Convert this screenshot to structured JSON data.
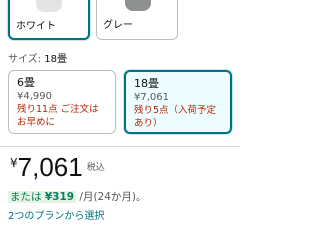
{
  "colors": [
    {
      "label": "ホワイト",
      "thumb": "#e2e4e4",
      "selected": true
    },
    {
      "label": "グレー",
      "thumb": "#8d9090",
      "selected": false
    }
  ],
  "size": {
    "label": "サイズ:",
    "value": "18畳"
  },
  "size_options": [
    {
      "title": "6畳",
      "price": "¥4,990",
      "stock": "残り11点 ご注文はお早めに",
      "selected": false
    },
    {
      "title": "18畳",
      "price": "¥7,061",
      "stock": "残り5点（入荷予定あり）",
      "selected": true
    }
  ],
  "price": {
    "yen": "¥",
    "amount": "7,061",
    "tax": "税込"
  },
  "installment": {
    "prefix": "または",
    "amount": "¥319",
    "suffix": "/月(24か月)。"
  },
  "plans_link": "2つのプランから選択"
}
